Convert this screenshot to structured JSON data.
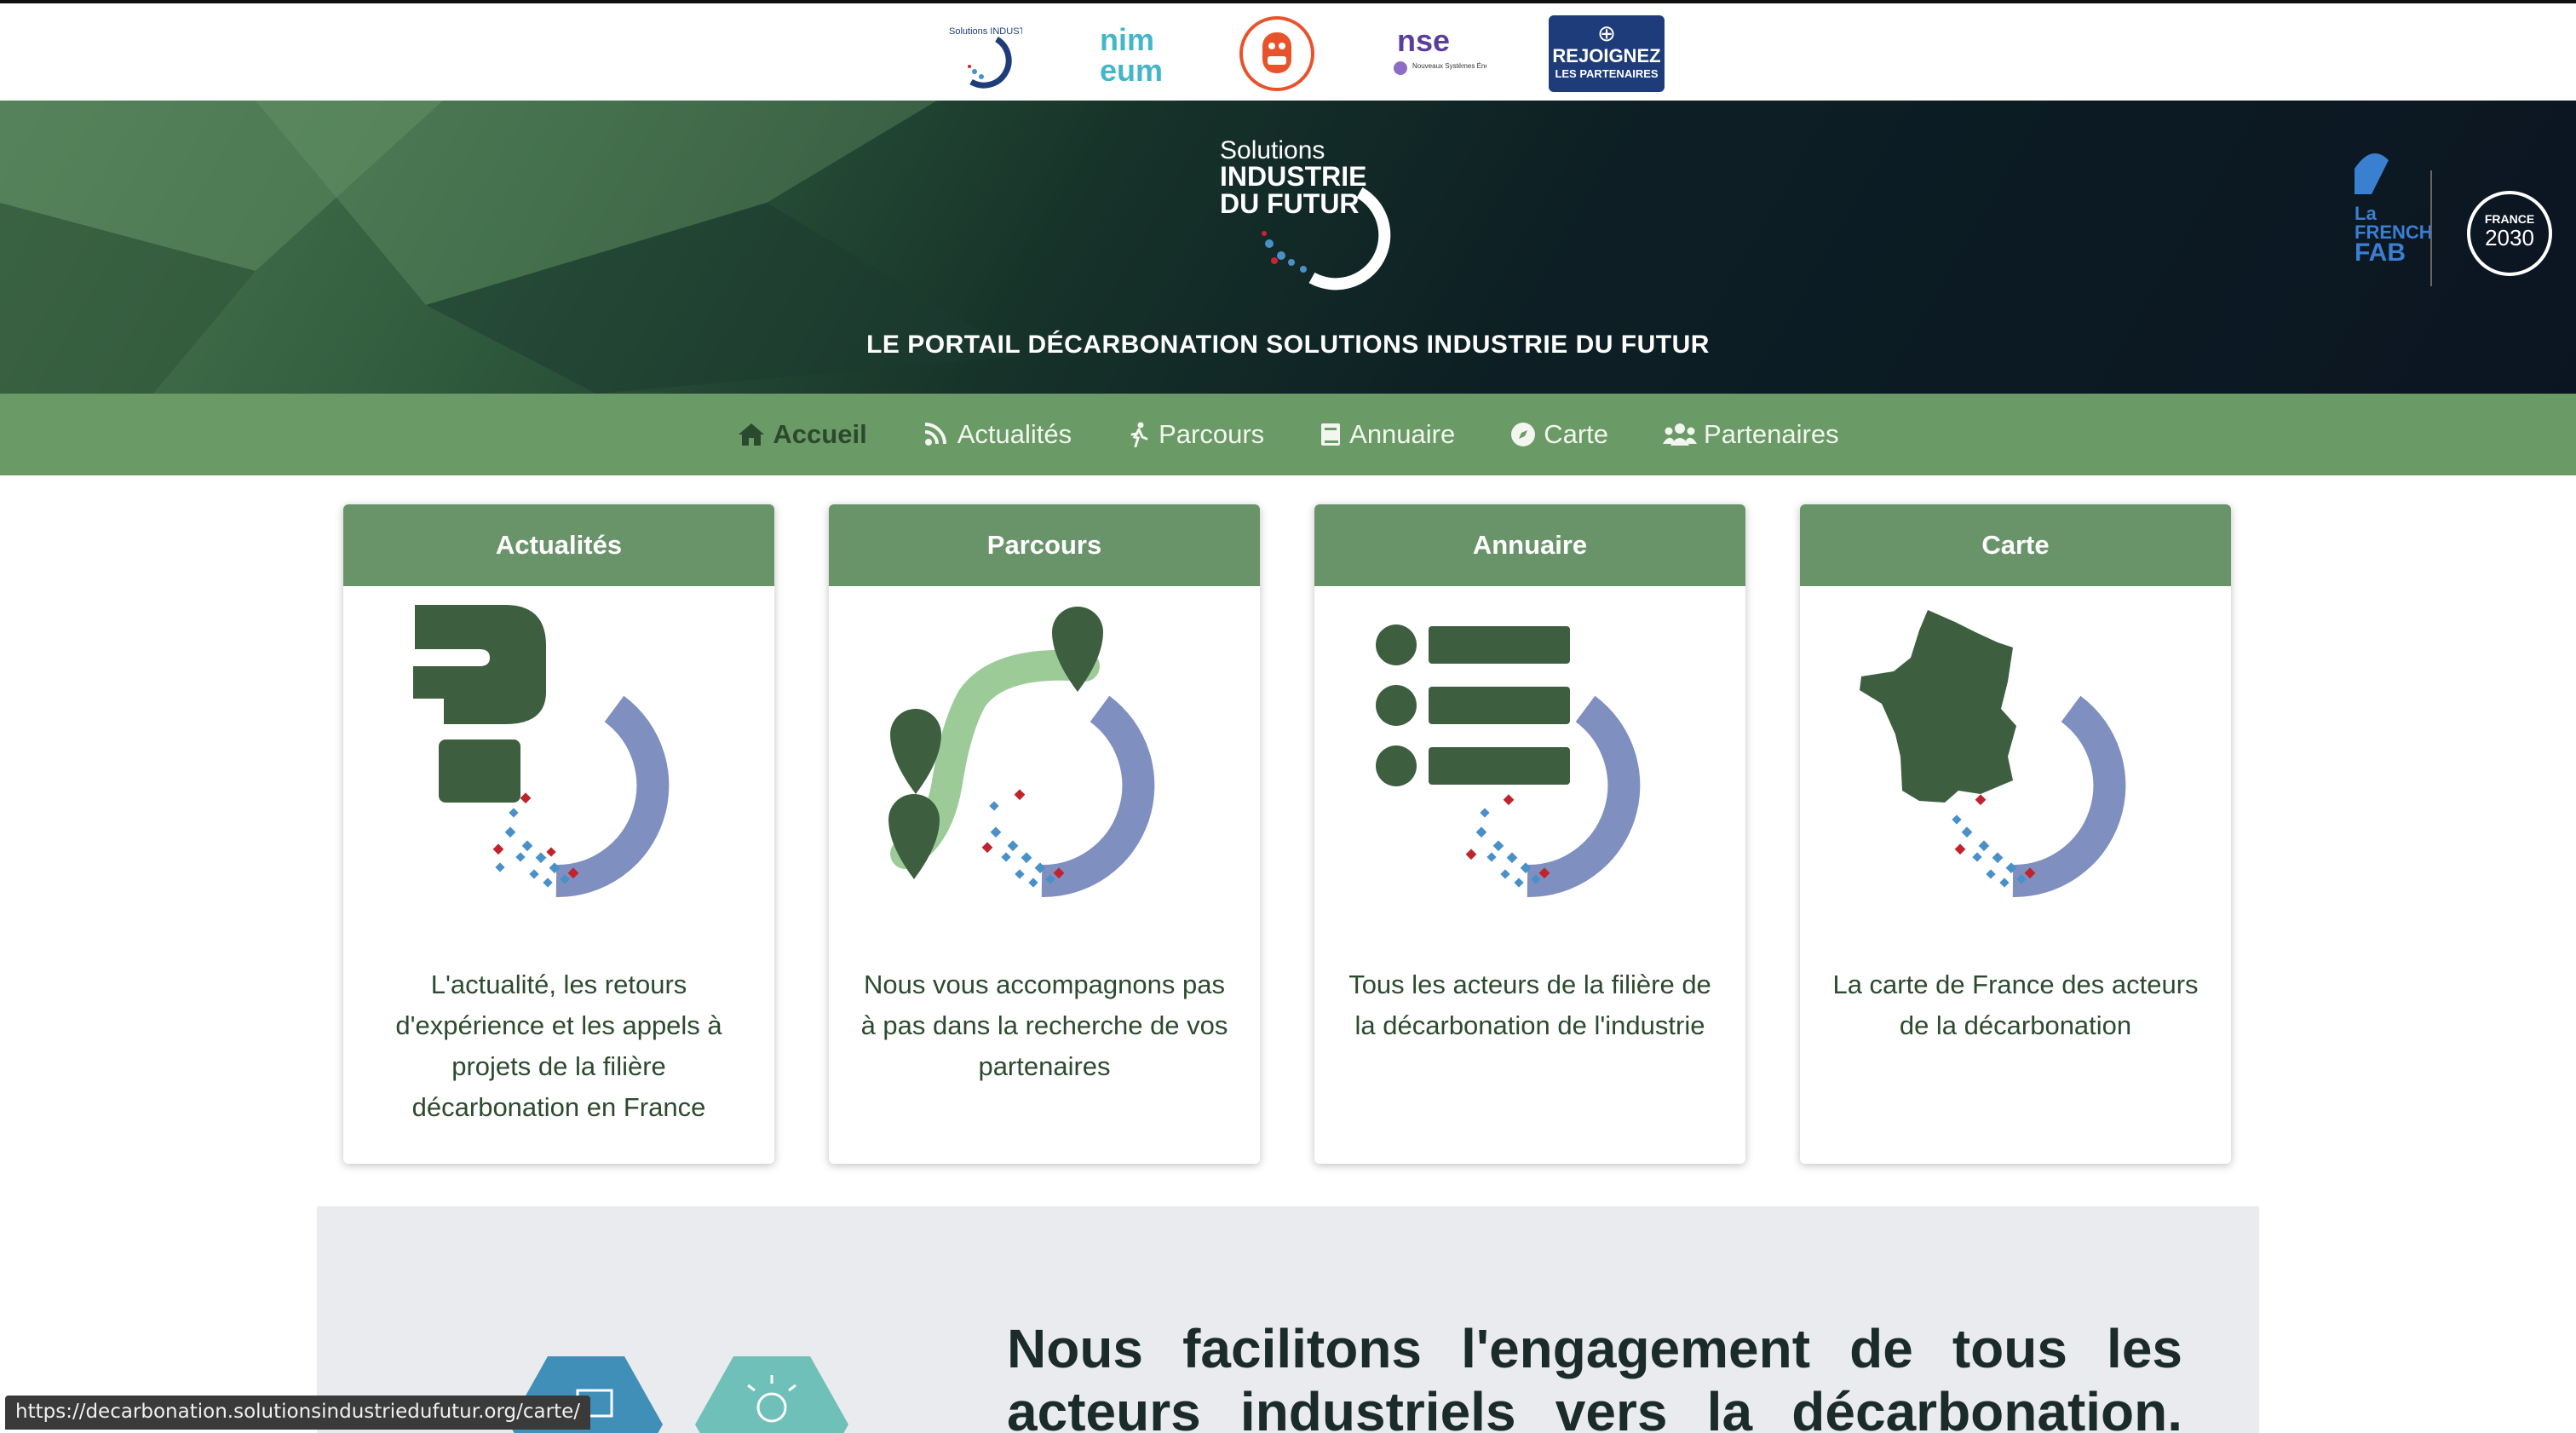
{
  "top_logos": {
    "sif_text": "Solutions INDUSTRIE DU FUTUR",
    "nimeum_text": "nim eum",
    "nse_text": "Nouveaux Systèmes Énergétiques",
    "join_line1": "REJOIGNEZ",
    "join_line2": "LES PARTENAIRES"
  },
  "hero": {
    "logo_line1": "Solutions",
    "logo_line2": "INDUSTRIE",
    "logo_line3": "DU FUTUR",
    "title": "LE PORTAIL DÉCARBONATION SOLUTIONS INDUSTRIE DU FUTUR",
    "french_fab_text": "La FRENCH FAB",
    "france2030_line1": "FRANCE",
    "france2030_line2": "2030"
  },
  "nav": {
    "items": [
      {
        "label": "Accueil",
        "icon": "home-icon",
        "active": true
      },
      {
        "label": "Actualités",
        "icon": "rss-icon"
      },
      {
        "label": "Parcours",
        "icon": "walking-icon"
      },
      {
        "label": "Annuaire",
        "icon": "book-icon"
      },
      {
        "label": "Carte",
        "icon": "compass-icon"
      },
      {
        "label": "Partenaires",
        "icon": "users-icon"
      }
    ]
  },
  "cards": [
    {
      "title": "Actualités",
      "text": "L'actualité, les retours d'expérience et les appels à projets de la filière décarbonation en France",
      "icon": "question-mark-icon"
    },
    {
      "title": "Parcours",
      "text": "Nous vous accompagnons pas à pas dans la recherche de vos partenaires",
      "icon": "route-pins-icon"
    },
    {
      "title": "Annuaire",
      "text": "Tous les acteurs de la filière de la décarbonation de l'industrie",
      "icon": "list-icon"
    },
    {
      "title": "Carte",
      "text": "La carte de France des acteurs de la décarbonation",
      "icon": "france-map-icon"
    }
  ],
  "bottom": {
    "heading": "Nous facilitons l'engagement de tous les acteurs industriels vers la décarbonation."
  },
  "status_bar": {
    "url": "https://decarbonation.solutionsindustriedufutur.org/carte/"
  },
  "colors": {
    "nav_green": "#6a9a65",
    "card_head_green": "#69946a",
    "dark_green_icon": "#3d5e3f",
    "ring_blue": "#7e8fc0",
    "light_green": "#9ccb98",
    "join_blue": "#1f3c7a"
  }
}
